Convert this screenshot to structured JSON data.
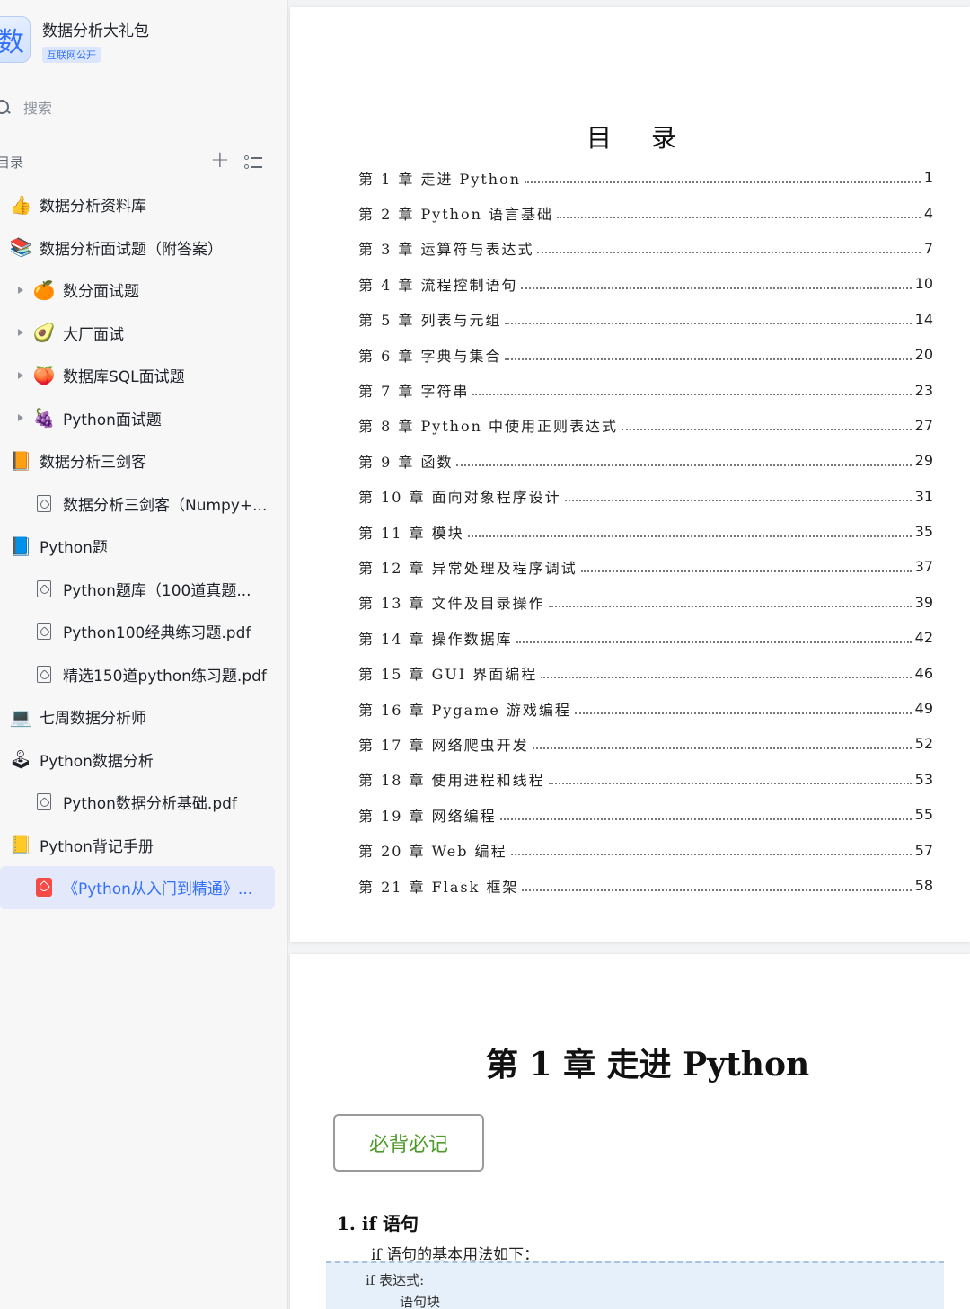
{
  "sidebar": {
    "kb_logo_char": "数",
    "kb_title": "数据分析大礼包",
    "kb_badge": "互联网公开",
    "search_placeholder": "搜索",
    "toc_label": "目录",
    "add_symbol": "+",
    "items": [
      {
        "label": "数据分析资料库",
        "icon": "thumbs-up-icon",
        "glyph": "👍",
        "level": 0,
        "arrow": false
      },
      {
        "label": "数据分析面试题（附答案）",
        "icon": "books-icon",
        "glyph": "📚",
        "level": 0,
        "arrow": false
      },
      {
        "label": "数分面试题",
        "icon": "tangerine-icon",
        "glyph": "🍊",
        "level": 1,
        "arrow": true
      },
      {
        "label": "大厂面试",
        "icon": "avocado-icon",
        "glyph": "🥑",
        "level": 1,
        "arrow": true
      },
      {
        "label": "数据库SQL面试题",
        "icon": "peach-icon",
        "glyph": "🍑",
        "level": 1,
        "arrow": true
      },
      {
        "label": "Python面试题",
        "icon": "grapes-icon",
        "glyph": "🍇",
        "level": 1,
        "arrow": true
      },
      {
        "label": "数据分析三剑客",
        "icon": "orange-book-icon",
        "glyph": "📙",
        "level": 0,
        "arrow": false
      },
      {
        "label": "数据分析三剑客（Numpy+...",
        "icon": "pdf-file-icon",
        "glyph": "",
        "level": 1,
        "arrow": false
      },
      {
        "label": "Python题",
        "icon": "blue-book-icon",
        "glyph": "📘",
        "level": 0,
        "arrow": false
      },
      {
        "label": "Python题库（100道真题...",
        "icon": "pdf-file-icon",
        "glyph": "",
        "level": 1,
        "arrow": false
      },
      {
        "label": "Python100经典练习题.pdf",
        "icon": "pdf-file-icon",
        "glyph": "",
        "level": 1,
        "arrow": false
      },
      {
        "label": "精选150道python练习题.pdf",
        "icon": "pdf-file-icon",
        "glyph": "",
        "level": 1,
        "arrow": false
      },
      {
        "label": "七周数据分析师",
        "icon": "computer-icon",
        "glyph": "💻",
        "level": 0,
        "arrow": false
      },
      {
        "label": "Python数据分析",
        "icon": "joystick-icon",
        "glyph": "🕹",
        "level": 0,
        "arrow": false
      },
      {
        "label": "Python数据分析基础.pdf",
        "icon": "pdf-file-icon",
        "glyph": "",
        "level": 1,
        "arrow": false
      },
      {
        "label": "Python背记手册",
        "icon": "folder-icon",
        "glyph": "📒",
        "level": 0,
        "arrow": false
      },
      {
        "label": "《Python从入门到精通》...",
        "icon": "pdf-red-icon",
        "glyph": "",
        "level": 1,
        "arrow": false,
        "active": true
      }
    ]
  },
  "document": {
    "toc_title": "目录",
    "toc": [
      {
        "text": "第 1 章  走进 Python",
        "page": "1"
      },
      {
        "text": "第 2 章  Python 语言基础",
        "page": "4"
      },
      {
        "text": "第 3 章  运算符与表达式",
        "page": "7"
      },
      {
        "text": "第 4 章  流程控制语句",
        "page": "10"
      },
      {
        "text": "第 5 章  列表与元组",
        "page": "14"
      },
      {
        "text": "第 6 章  字典与集合",
        "page": "20"
      },
      {
        "text": "第 7 章  字符串",
        "page": "23"
      },
      {
        "text": "第 8 章  Python 中使用正则表达式",
        "page": "27"
      },
      {
        "text": "第 9 章  函数",
        "page": "29"
      },
      {
        "text": "第 10 章  面向对象程序设计",
        "page": "31"
      },
      {
        "text": "第 11 章  模块",
        "page": "35"
      },
      {
        "text": "第 12 章  异常处理及程序调试",
        "page": "37"
      },
      {
        "text": "第 13 章  文件及目录操作",
        "page": "39"
      },
      {
        "text": "第 14 章  操作数据库",
        "page": "42"
      },
      {
        "text": "第 15 章  GUI 界面编程",
        "page": "46"
      },
      {
        "text": "第 16 章  Pygame 游戏编程",
        "page": "49"
      },
      {
        "text": "第 17 章  网络爬虫开发",
        "page": "52"
      },
      {
        "text": "第 18 章  使用进程和线程",
        "page": "53"
      },
      {
        "text": "第 19 章  网络编程",
        "page": "55"
      },
      {
        "text": "第 20 章  Web 编程",
        "page": "57"
      },
      {
        "text": "第 21 章  Flask 框架",
        "page": "58"
      }
    ],
    "chapter_title": "第 1 章  走进 Python",
    "memo_box": "必背必记",
    "section_title": "1. if 语句",
    "paragraph": "if 语句的基本用法如下：",
    "code_lines": [
      "if 表达式:",
      "语句块"
    ]
  },
  "colors": {
    "accent": "#3370ff",
    "active_bg": "#e3e8fa",
    "memo_green": "#4e9a2a",
    "code_bg": "#e6f0fa"
  }
}
